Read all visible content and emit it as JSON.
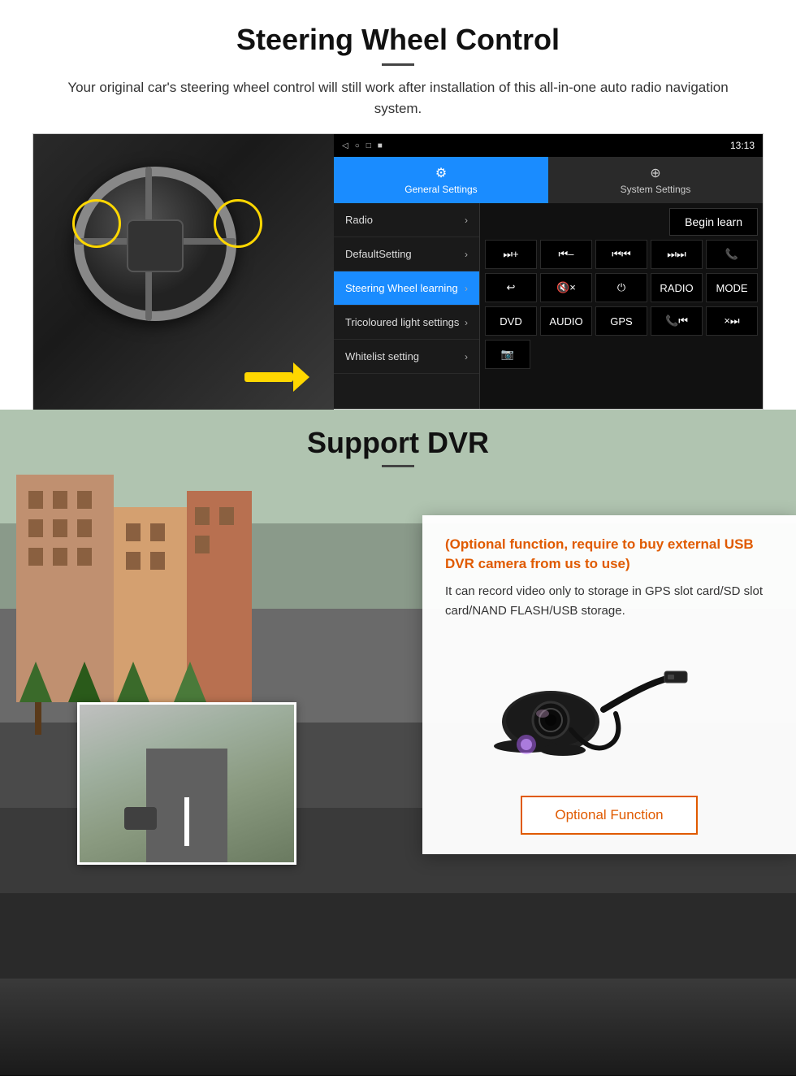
{
  "steering": {
    "title": "Steering Wheel Control",
    "subtitle": "Your original car's steering wheel control will still work after installation of this all-in-one auto radio navigation system.",
    "android": {
      "statusbar": {
        "time": "13:13",
        "nav_icons": [
          "◁",
          "○",
          "□",
          "■"
        ]
      },
      "tabs": [
        {
          "label": "General Settings",
          "icon": "⚙",
          "active": true
        },
        {
          "label": "System Settings",
          "icon": "🌐",
          "active": false
        }
      ],
      "menu_items": [
        {
          "label": "Radio",
          "active": false
        },
        {
          "label": "DefaultSetting",
          "active": false
        },
        {
          "label": "Steering Wheel learning",
          "active": true
        },
        {
          "label": "Tricoloured light settings",
          "active": false
        },
        {
          "label": "Whitelist setting",
          "active": false
        }
      ],
      "begin_learn_label": "Begin learn",
      "control_buttons": [
        [
          "⏮+",
          "⏮-",
          "⏮⏮",
          "⏭⏭",
          "📞"
        ],
        [
          "↩",
          "🔇×",
          "⏻",
          "RADIO",
          "MODE"
        ],
        [
          "DVD",
          "AUDIO",
          "GPS",
          "📞⏮",
          "×⏭⏭"
        ],
        [
          "📹"
        ]
      ]
    }
  },
  "dvr": {
    "title": "Support DVR",
    "optional_text": "(Optional function, require to buy external USB DVR camera from us to use)",
    "description": "It can record video only to storage in GPS slot card/SD slot card/NAND FLASH/USB storage.",
    "optional_function_label": "Optional Function"
  }
}
